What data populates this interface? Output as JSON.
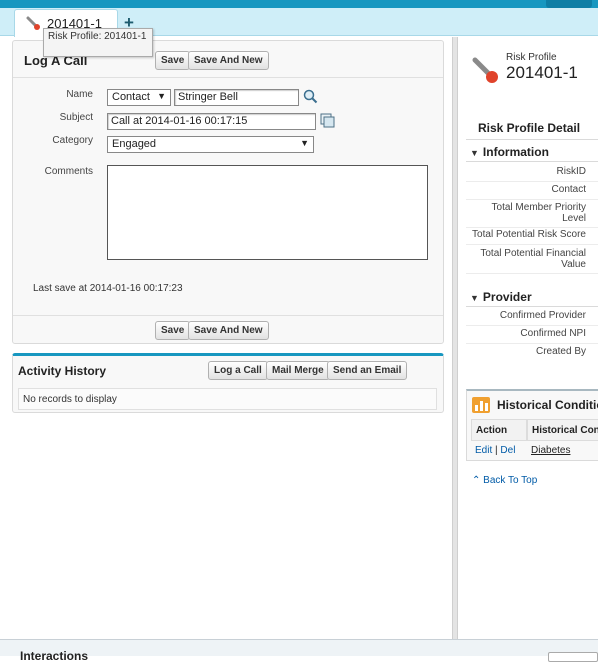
{
  "tabs": {
    "active_label": "201401-1",
    "add_label": "+",
    "tooltip": "Risk Profile: 201401-1"
  },
  "log_call": {
    "title": "Log A Call",
    "save_label": "Save",
    "save_new_label": "Save And New",
    "name_label": "Name",
    "name_type": "Contact",
    "name_value": "Stringer Bell",
    "subject_label": "Subject",
    "subject_value": "Call at 2014-01-16 00:17:15",
    "category_label": "Category",
    "category_value": "Engaged",
    "comments_label": "Comments",
    "comments_value": "",
    "last_save": "Last save at 2014-01-16 00:17:23"
  },
  "activity_history": {
    "title": "Activity History",
    "log_call_label": "Log a Call",
    "mail_merge_label": "Mail Merge",
    "send_email_label": "Send an Email",
    "empty_text": "No records to display"
  },
  "risk_profile": {
    "subtitle": "Risk Profile",
    "title": "201401-1",
    "detail_heading": "Risk Profile Detail",
    "information_heading": "Information",
    "information_fields": [
      "RiskID",
      "Contact",
      "Total Member Priority Level",
      "Total Potential Risk Score",
      "Total Potential Financial Value"
    ],
    "provider_heading": "Provider",
    "provider_fields": [
      "Confirmed Provider",
      "Confirmed NPI",
      "Created By"
    ],
    "historical": {
      "title": "Historical Conditions",
      "col_action": "Action",
      "col_condition": "Historical Con",
      "edit": "Edit",
      "sep": "|",
      "del": "Del",
      "condition_value": "Diabetes"
    },
    "back_to_top": "Back To Top"
  },
  "bottom": {
    "label": "Interactions"
  },
  "colors": {
    "accent": "#1797c0",
    "link": "#015ba7",
    "tab_bar": "#cfeef8"
  }
}
